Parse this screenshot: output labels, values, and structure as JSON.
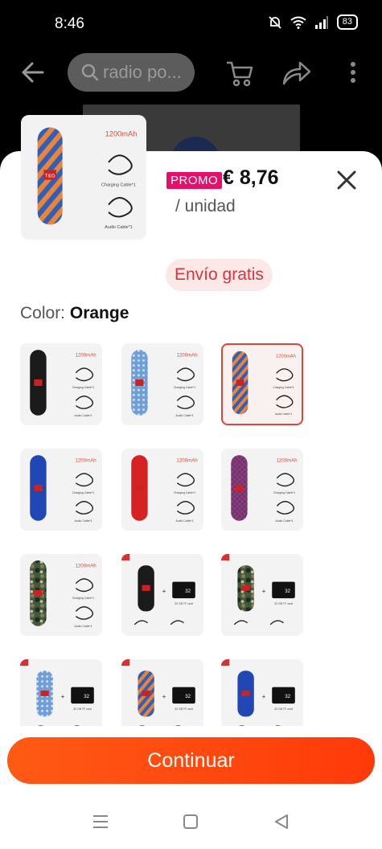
{
  "status_bar": {
    "time": "8:46",
    "battery": "83"
  },
  "search": {
    "placeholder": "radio po..."
  },
  "product": {
    "promo_label": "PROMO",
    "price": "€ 8,76",
    "unit": "/ unidad",
    "shipping": "Envío gratis"
  },
  "thumb_text": {
    "capacity": "1200mAh",
    "charging": "Charging Cable*1",
    "audio": "Audio Cable*1",
    "card": "32 GB TF card",
    "card_chip": "32",
    "brand": "T&G"
  },
  "color": {
    "label": "Color:",
    "value": "Orange"
  },
  "variants": [
    {
      "color": "black",
      "kind": "cables"
    },
    {
      "color": "lightblue",
      "kind": "cables"
    },
    {
      "color": "orange-stripe",
      "kind": "cables",
      "selected": true
    },
    {
      "color": "blue",
      "kind": "cables"
    },
    {
      "color": "red",
      "kind": "cables"
    },
    {
      "color": "red-blue",
      "kind": "cables"
    },
    {
      "color": "camo",
      "kind": "cables"
    },
    {
      "color": "black",
      "kind": "card"
    },
    {
      "color": "camo",
      "kind": "card"
    },
    {
      "color": "lightblue",
      "kind": "card"
    },
    {
      "color": "orange-stripe",
      "kind": "card"
    },
    {
      "color": "blue",
      "kind": "card"
    }
  ],
  "continue_label": "Continuar",
  "colors": {
    "accent": "#ff4e10",
    "promo": "#e5106a",
    "shipping_text": "#e0323a",
    "selected_border": "#e0453c"
  }
}
